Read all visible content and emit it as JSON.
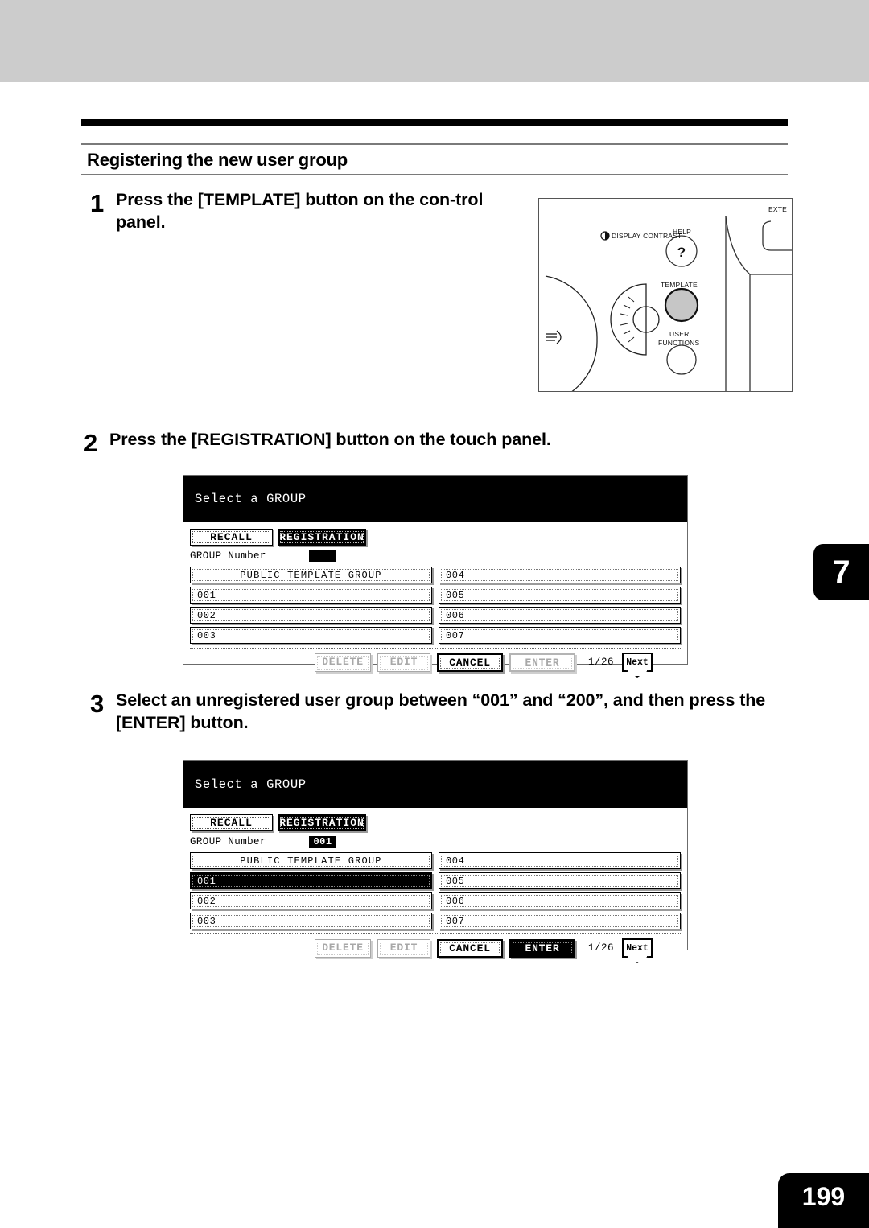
{
  "page": {
    "chapter_tab": "7",
    "page_number": "199",
    "section_title": "Registering the new user group"
  },
  "steps": [
    {
      "number": "1",
      "text": "Press the [TEMPLATE] button on the con-trol panel."
    },
    {
      "number": "2",
      "text": "Press the [REGISTRATION] button on the touch panel."
    },
    {
      "number": "3",
      "text": "Select an unregistered user group between “001” and “200”, and then press the [ENTER] button."
    }
  ],
  "control_panel": {
    "display_contrast_label": "DISPLAY CONTRAST",
    "help_label": "HELP",
    "help_glyph": "?",
    "template_label": "TEMPLATE",
    "user_functions_label_line1": "USER",
    "user_functions_label_line2": "FUNCTIONS",
    "external_label": "EXTE"
  },
  "lcd_step2": {
    "title": "Select a GROUP",
    "tab_recall": "RECALL",
    "tab_registration": "REGISTRATION",
    "group_number_label": "GROUP Number",
    "group_number_value": "",
    "groups_left": [
      "PUBLIC TEMPLATE GROUP",
      "001",
      "002",
      "003"
    ],
    "groups_right": [
      "004",
      "005",
      "006",
      "007"
    ],
    "selected_group": "",
    "btn_delete": "DELETE",
    "btn_edit": "EDIT",
    "btn_cancel": "CANCEL",
    "btn_enter": "ENTER",
    "page_count": "1/26",
    "btn_next": "Next"
  },
  "lcd_step3": {
    "title": "Select a GROUP",
    "tab_recall": "RECALL",
    "tab_registration": "REGISTRATION",
    "group_number_label": "GROUP Number",
    "group_number_value": "001",
    "groups_left": [
      "PUBLIC TEMPLATE GROUP",
      "001",
      "002",
      "003"
    ],
    "groups_right": [
      "004",
      "005",
      "006",
      "007"
    ],
    "selected_group": "001",
    "btn_delete": "DELETE",
    "btn_edit": "EDIT",
    "btn_cancel": "CANCEL",
    "btn_enter": "ENTER",
    "page_count": "1/26",
    "btn_next": "Next"
  },
  "colors": {
    "top_band": "#cccccc",
    "ink": "#000000",
    "disabled": "#a8a8a8"
  }
}
